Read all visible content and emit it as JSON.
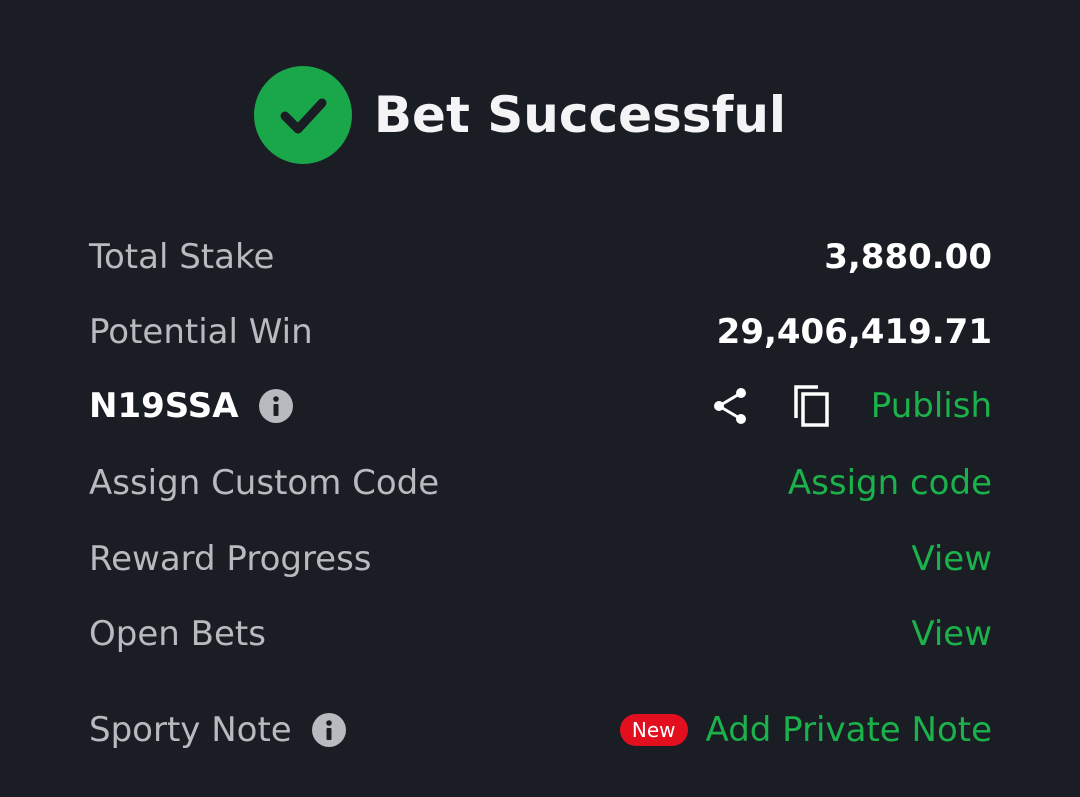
{
  "header": {
    "title": "Bet Successful",
    "icon": "check-circle-icon",
    "icon_color": "#1aa74a"
  },
  "rows": {
    "total_stake": {
      "label": "Total Stake",
      "value": "3,880.00"
    },
    "potential_win": {
      "label": "Potential Win",
      "value": "29,406,419.71"
    },
    "booking_code": {
      "code": "N19SSA",
      "publish_label": "Publish"
    },
    "custom_code": {
      "label": "Assign Custom Code",
      "action": "Assign code"
    },
    "reward_progress": {
      "label": "Reward Progress",
      "action": "View"
    },
    "open_bets": {
      "label": "Open Bets",
      "action": "View"
    },
    "sporty_note": {
      "label": "Sporty Note",
      "badge": "New",
      "action": "Add Private Note"
    }
  },
  "colors": {
    "background": "#1b1d24",
    "accent_green": "#1bb24b",
    "label_grey": "#b8bac0",
    "badge_red": "#e2101f"
  }
}
